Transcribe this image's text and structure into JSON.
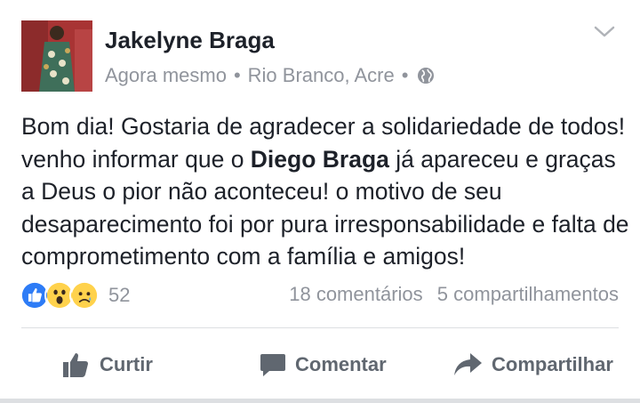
{
  "post": {
    "author": "Jakelyne Braga",
    "time": "Agora mesmo",
    "location": "Rio Branco, Acre",
    "separator": "•",
    "privacy_icon": "globe-icon",
    "menu_icon": "chevron-down-icon",
    "body": {
      "part1": "Bom dia! Gostaria de agradecer a solidariedade de todos! venho informar que o ",
      "bold": "Diego Braga",
      "part2": " já apareceu e graças a Deus o pior não aconteceu! o motivo de seu desaparecimento foi por pura irresponsabilidade e falta de comprometimento com a família e amigos!"
    }
  },
  "reactions": {
    "icons": [
      "like-icon",
      "wow-icon",
      "sad-icon"
    ],
    "count": "52"
  },
  "stats": {
    "comments": "18 comentários",
    "shares": "5 compartilhamentos"
  },
  "actions": {
    "like": "Curtir",
    "comment": "Comentar",
    "share": "Compartilhar"
  },
  "colors": {
    "text": "#1d2129",
    "meta": "#90949c",
    "action": "#606770",
    "like_blue": "#2e7cf6",
    "emoji_yellow": "#ffd24c"
  }
}
